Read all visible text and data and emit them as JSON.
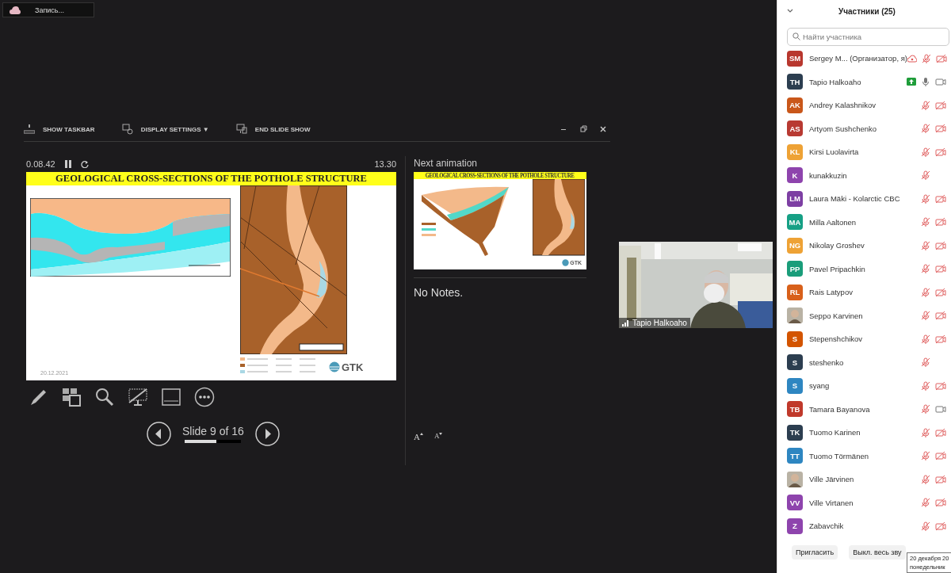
{
  "recording": {
    "label": "Запись..."
  },
  "presenter": {
    "toolbar": [
      "SHOW TASKBAR",
      "DISPLAY SETTINGS ▼",
      "END SLIDE SHOW"
    ],
    "elapsed": "0.08.42",
    "clock": "13.30",
    "slide": {
      "title": "GEOLOGICAL CROSS-SECTIONS OF THE POTHOLE STRUCTURE",
      "date": "20.12.2021",
      "logo": "GTK"
    },
    "slide_counter": "Slide 9 of 16",
    "level": 0.56,
    "next_label": "Next animation",
    "next_slide": {
      "title": "GEOLOGICAL CROSS-SECTIONS OF THE POTHOLE STRUCTURE",
      "logo": "GTK"
    },
    "notes": "No Notes.",
    "font_buttons": [
      "A",
      "A"
    ]
  },
  "video": {
    "name": "Tapio Halkoaho"
  },
  "participants": {
    "title": "Участники (25)",
    "search": {
      "placeholder": "Найти участника"
    },
    "items": [
      {
        "kind": "initials",
        "initials": "SM",
        "color": "#b8372e",
        "name": "Sergey M... (Организатор, я)",
        "recording": true,
        "sharing": false,
        "mic_muted": true,
        "camera_off": true
      },
      {
        "kind": "initials",
        "initials": "TH",
        "color": "#2c3e50",
        "name": "Tapio Halkoaho",
        "recording": false,
        "sharing": true,
        "mic_muted": false,
        "camera_off": false
      },
      {
        "kind": "initials",
        "initials": "AK",
        "color": "#c9571a",
        "name": "Andrey Kalashnikov",
        "recording": false,
        "sharing": false,
        "mic_muted": true,
        "camera_off": true
      },
      {
        "kind": "initials",
        "initials": "AS",
        "color": "#b83a32",
        "name": "Artyom Sushchenko",
        "recording": false,
        "sharing": false,
        "mic_muted": true,
        "camera_off": true
      },
      {
        "kind": "initials",
        "initials": "KL",
        "color": "#eea235",
        "name": "Kirsi Luolavirta",
        "recording": false,
        "sharing": false,
        "mic_muted": true,
        "camera_off": true
      },
      {
        "kind": "initials",
        "initials": "K",
        "color": "#8e44ad",
        "name": "kunakkuzin",
        "recording": false,
        "sharing": false,
        "mic_muted": true
      },
      {
        "kind": "initials",
        "initials": "LM",
        "color": "#7d3fa3",
        "name": "Laura Mäki - Kolarctic CBC",
        "recording": false,
        "sharing": false,
        "mic_muted": true,
        "camera_off": true
      },
      {
        "kind": "initials",
        "initials": "MA",
        "color": "#16a085",
        "name": "Milla Aaltonen",
        "recording": false,
        "sharing": false,
        "mic_muted": true,
        "camera_off": true
      },
      {
        "kind": "initials",
        "initials": "NG",
        "color": "#eea235",
        "name": "Nikolay Groshev",
        "recording": false,
        "sharing": false,
        "mic_muted": true,
        "camera_off": true
      },
      {
        "kind": "initials",
        "initials": "PP",
        "color": "#1a9d7a",
        "name": "Pavel Pripachkin",
        "recording": false,
        "sharing": false,
        "mic_muted": true,
        "camera_off": true
      },
      {
        "kind": "initials",
        "initials": "RL",
        "color": "#d8601a",
        "name": "Rais Latypov",
        "recording": false,
        "sharing": false,
        "mic_muted": true,
        "camera_off": true
      },
      {
        "name": "Seppo Karvinen",
        "recording": false,
        "sharing": false,
        "mic_muted": true,
        "camera_off": true
      },
      {
        "kind": "initials",
        "initials": "S",
        "color": "#d35400",
        "name": "Stepenshchikov",
        "recording": false,
        "sharing": false,
        "mic_muted": true,
        "camera_off": true
      },
      {
        "kind": "initials",
        "initials": "S",
        "color": "#2c3e50",
        "name": "steshenko",
        "recording": false,
        "sharing": false,
        "mic_muted": true
      },
      {
        "kind": "initials",
        "initials": "S",
        "color": "#2e86c1",
        "name": "syang",
        "recording": false,
        "sharing": false,
        "mic_muted": true,
        "camera_off": true
      },
      {
        "kind": "initials",
        "initials": "TB",
        "color": "#c0392b",
        "name": "Tamara Bayanova",
        "recording": false,
        "sharing": false,
        "mic_muted": true,
        "camera_off": false
      },
      {
        "kind": "initials",
        "initials": "TK",
        "color": "#2c3e50",
        "name": "Tuomo Karinen",
        "recording": false,
        "sharing": false,
        "mic_muted": true,
        "camera_off": true
      },
      {
        "kind": "initials",
        "initials": "TT",
        "color": "#2e86c1",
        "name": "Tuomo Törmänen",
        "recording": false,
        "sharing": false,
        "mic_muted": true,
        "camera_off": true
      },
      {
        "name": "Ville Järvinen",
        "recording": false,
        "sharing": false,
        "mic_muted": true,
        "camera_off": true
      },
      {
        "kind": "initials",
        "initials": "VV",
        "color": "#8e44ad",
        "name": "Ville Virtanen",
        "recording": false,
        "sharing": false,
        "mic_muted": true,
        "camera_off": true
      },
      {
        "kind": "initials",
        "initials": "Z",
        "color": "#8e44ad",
        "name": "Zabavchik",
        "recording": false,
        "sharing": false,
        "mic_muted": true,
        "camera_off": true
      }
    ]
  },
  "buttons": [
    "Пригласить",
    "Выкл. весь зву"
  ],
  "tooltip": [
    "20 декабря 20",
    "понедельник"
  ]
}
